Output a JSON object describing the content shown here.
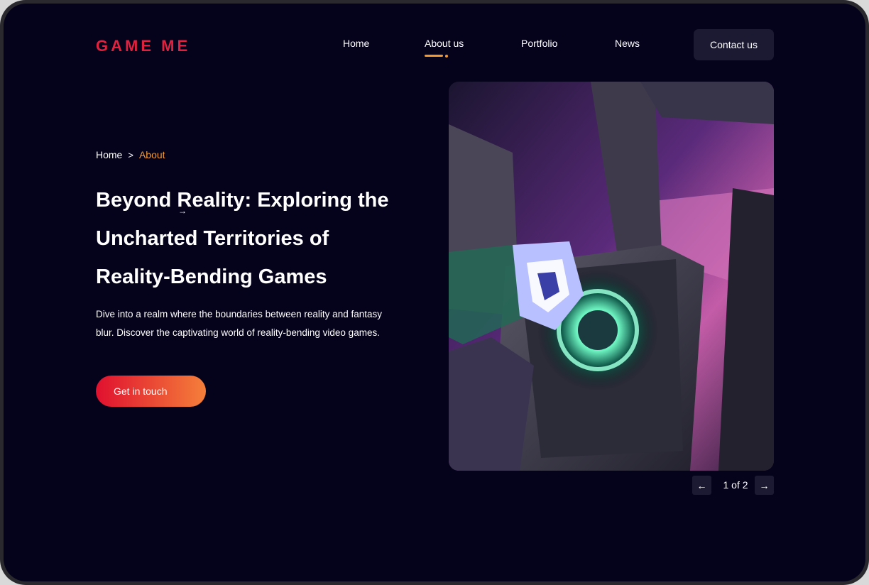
{
  "brand": {
    "logo_text": "GAME ME",
    "accent": "#e0223f"
  },
  "nav": {
    "items": [
      {
        "label": "Home"
      },
      {
        "label": "About us",
        "active": true
      },
      {
        "label": "Portfolio"
      },
      {
        "label": "News"
      }
    ],
    "contact_label": "Contact us",
    "active_color": "#f39a2f"
  },
  "breadcrumb": {
    "home": "Home",
    "separator": ">",
    "current": "About"
  },
  "hero": {
    "headline": "Beyond Reality: Exploring the Uncharted Territories of Reality-Bending Games",
    "description": "Dive into a realm where the boundaries between reality and fantasy blur. Discover the captivating world of reality-bending video games.",
    "cta_label": "Get in touch",
    "cta_gradient": [
      "#e0102f",
      "#f47f3a"
    ]
  },
  "gallery": {
    "prev_icon": "arrow-left-icon",
    "next_icon": "arrow-right-icon",
    "counter": "1 of 2"
  },
  "colors": {
    "background": "#05021c",
    "button_dark": "#1c1a32"
  }
}
